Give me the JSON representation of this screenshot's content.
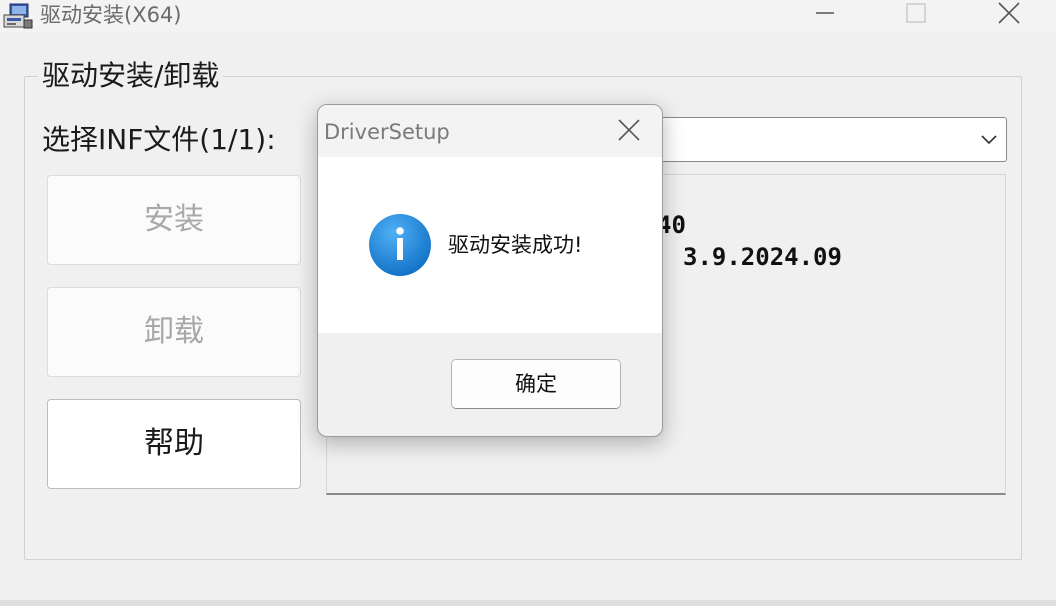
{
  "window": {
    "title": "驱动安装(X64)",
    "icon": "installer-app-icon",
    "controls": {
      "minimize_icon": "minimize-icon",
      "maximize_icon": "maximize-icon",
      "close_icon": "close-icon"
    }
  },
  "group": {
    "legend": "驱动安装/卸载",
    "inf_label": "选择INF文件(1/1):",
    "select": {
      "selected_value": "",
      "arrow_icon": "chevron-down-icon"
    },
    "buttons": {
      "install": "安装",
      "uninstall": "卸载",
      "help": "帮助"
    },
    "info_lines": [
      "40",
      "3.9.2024.09"
    ]
  },
  "dialog": {
    "title": "DriverSetup",
    "message": "驱动安装成功!",
    "icon": "info-icon",
    "ok_label": "确定"
  },
  "colors": {
    "info_icon_blue": "#1a7fd4",
    "window_bg": "#f0f0f0"
  }
}
